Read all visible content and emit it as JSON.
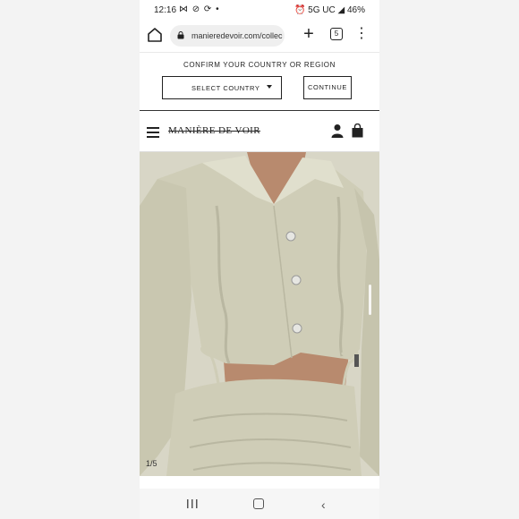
{
  "status_bar": {
    "time": "12:16",
    "left_icons": "⋈ ⊘ ⟳ •",
    "right_text": "⏰ 5G UC ◢ 46%"
  },
  "browser": {
    "url": "manieredevoir.com/collec",
    "tab_count": "5",
    "new_tab_label": "+",
    "menu_label": "⋮"
  },
  "country_bar": {
    "title": "CONFIRM YOUR COUNTRY OR REGION",
    "select_label": "SELECT COUNTRY",
    "continue_label": "CONTINUE"
  },
  "site_header": {
    "logo": "MANIÈRE DE VOIR"
  },
  "product": {
    "image_counter": "1/5",
    "image_colors": {
      "background": "#d8d6c6",
      "garment": "#cfcdb7",
      "garment_shadow": "#b9b7a1",
      "skin": "#b88a6e"
    }
  },
  "nav_bar": {
    "back_label": "‹"
  }
}
